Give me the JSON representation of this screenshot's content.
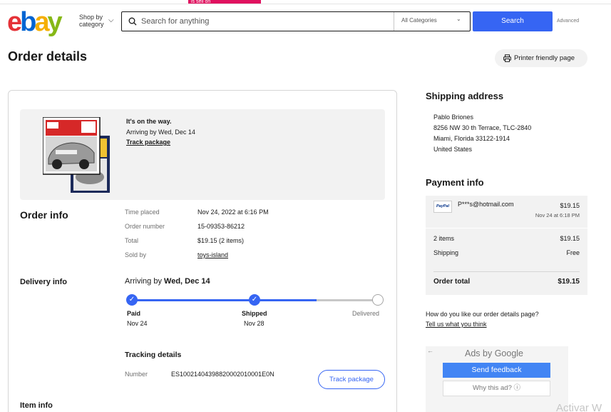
{
  "promo": {
    "text": "is sell on"
  },
  "header": {
    "shop_by_line1": "Shop by",
    "shop_by_line2": "category",
    "search_placeholder": "Search for anything",
    "category": "All Categories",
    "search_button": "Search",
    "advanced": "Advanced"
  },
  "page": {
    "title": "Order details",
    "printer_button": "Printer friendly page"
  },
  "status": {
    "line1": "It's on the way.",
    "line2": "Arriving by Wed, Dec 14",
    "track_link": "Track package"
  },
  "order_info": {
    "heading": "Order info",
    "rows": [
      {
        "label": "Time placed",
        "value": "Nov 24, 2022 at 6:16 PM"
      },
      {
        "label": "Order number",
        "value": "15-09353-86212"
      },
      {
        "label": "Total",
        "value": "$19.15 (2 items)"
      },
      {
        "label": "Sold by",
        "value": "toys-island"
      }
    ]
  },
  "delivery": {
    "heading": "Delivery info",
    "arriving_prefix": "Arriving by ",
    "arriving_date": "Wed, Dec 14",
    "progress": 0.75,
    "steps": [
      {
        "label": "Paid",
        "date": "Nov 24",
        "done": true
      },
      {
        "label": "Shipped",
        "date": "Nov 28",
        "done": true
      },
      {
        "label": "Delivered",
        "date": "",
        "done": false
      }
    ]
  },
  "tracking": {
    "heading": "Tracking details",
    "number_label": "Number",
    "number": "ES10021404398820002010001E0N",
    "button": "Track package"
  },
  "item_info": {
    "heading": "Item info"
  },
  "shipping": {
    "heading": "Shipping address",
    "lines": [
      "Pablo Briones",
      "8256 NW 30 th Terrace, TLC-2840",
      "Miami, Florida 33122-1914",
      "United States"
    ]
  },
  "payment": {
    "heading": "Payment info",
    "method_logo": "PayPal",
    "email": "P***s@hotmail.com",
    "amount": "$19.15",
    "date": "Nov 24 at 6:18 PM",
    "summary": [
      {
        "label": "2 items",
        "value": "$19.15"
      },
      {
        "label": "Shipping",
        "value": "Free"
      }
    ],
    "total_label": "Order total",
    "total_value": "$19.15"
  },
  "feedback": {
    "question": "How do you like our order details page?",
    "link": "Tell us what you think"
  },
  "ads": {
    "ads_by": "Ads by",
    "google": "Google",
    "send_feedback": "Send feedback",
    "why_ad": "Why this ad?"
  },
  "watermark": {
    "text": "Activar W"
  },
  "colors": {
    "accent": "#3665f3",
    "promo": "#e0115f",
    "panel": "#f2f2f2"
  }
}
